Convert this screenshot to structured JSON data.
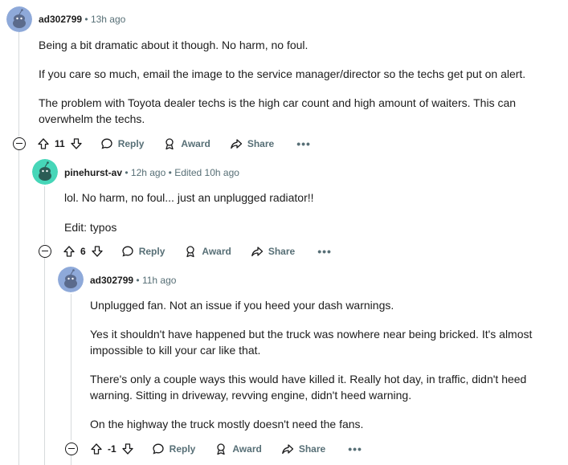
{
  "colors": {
    "thread_line": "#d7dadc",
    "meta_text": "#576f76",
    "avatar_blue": "#8ea9d9",
    "avatar_teal": "#46d6b8"
  },
  "comments": [
    {
      "author": "ad302799",
      "meta": "13h ago",
      "paragraphs": [
        "Being a bit dramatic about it though. No harm, no foul.",
        "If you care so much, email the image to the service manager/director so the techs get put on alert.",
        "The problem with Toyota dealer techs is the high car count and high amount of waiters. This can overwhelm the techs."
      ],
      "score": "11",
      "reply": "Reply",
      "award": "Award",
      "share": "Share",
      "more": "•••"
    },
    {
      "author": "pinehurst-av",
      "meta": "12h ago",
      "edited": "Edited 10h ago",
      "paragraphs": [
        "lol. No harm, no foul... just an unplugged radiator!!",
        "Edit: typos"
      ],
      "score": "6",
      "reply": "Reply",
      "award": "Award",
      "share": "Share",
      "more": "•••"
    },
    {
      "author": "ad302799",
      "meta": "11h ago",
      "paragraphs": [
        "Unplugged fan. Not an issue if you heed your dash warnings.",
        "Yes it shouldn't have happened but the truck was nowhere near being bricked. It's almost impossible to kill your car like that.",
        "There's only a couple ways this would have killed it. Really hot day, in traffic, didn't heed warning. Sitting in driveway, revving engine, didn't heed warning.",
        "On the highway the truck mostly doesn't need the fans."
      ],
      "score": "-1",
      "reply": "Reply",
      "award": "Award",
      "share": "Share",
      "more": "•••"
    }
  ]
}
